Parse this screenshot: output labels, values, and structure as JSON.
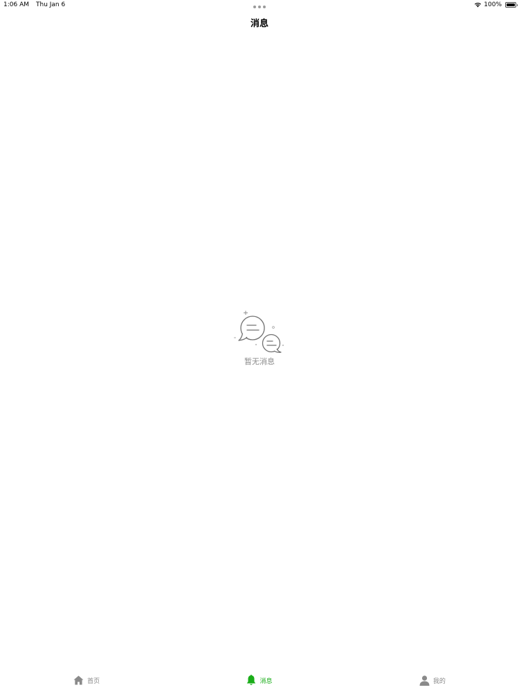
{
  "status_bar": {
    "time": "1:06 AM",
    "date": "Thu Jan 6",
    "battery": "100%",
    "battery_level": 1.0
  },
  "nav": {
    "title": "消息"
  },
  "empty_state": {
    "icon": "chat-bubbles-icon",
    "message": "暂无消息"
  },
  "tab_bar": {
    "tabs": [
      {
        "label": "首页",
        "icon": "home-icon",
        "active": false
      },
      {
        "label": "消息",
        "icon": "bell-icon",
        "active": true
      },
      {
        "label": "我的",
        "icon": "user-icon",
        "active": false
      }
    ]
  },
  "colors": {
    "active_tab": "#1aad19",
    "inactive_tab": "#8a8a8a",
    "empty_text": "#8a8a8a",
    "background": "#ffffff"
  }
}
